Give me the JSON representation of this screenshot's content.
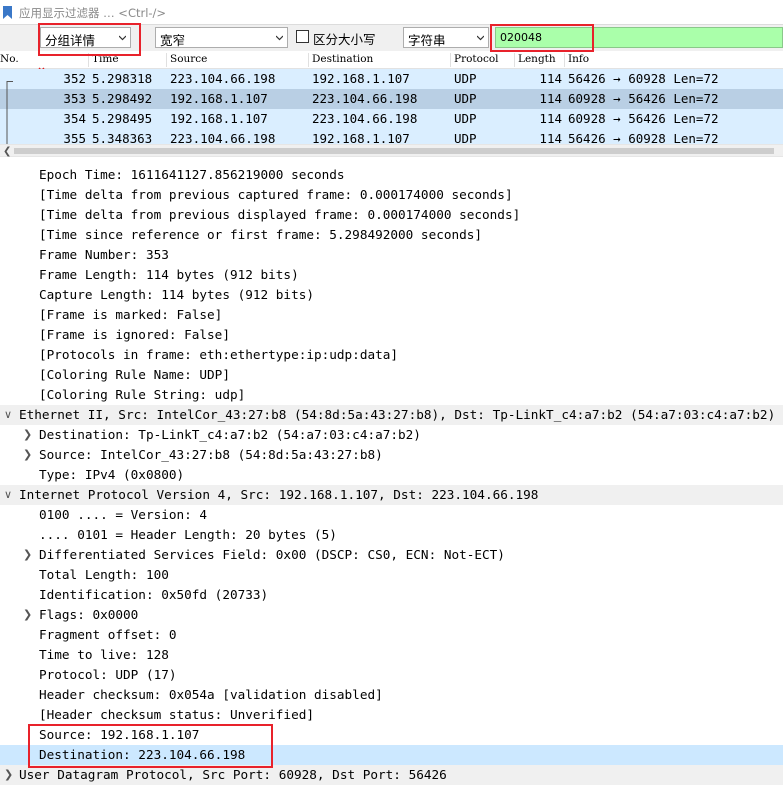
{
  "filter": {
    "placeholder": "应用显示过滤器 … <Ctrl-/>"
  },
  "find": {
    "scope": "分组详情",
    "charset": "宽窄",
    "case_label": "区分大小写",
    "type": "字符串",
    "query": "020048"
  },
  "packet_list": {
    "columns": [
      "No.",
      "Time",
      "Source",
      "Destination",
      "Protocol",
      "Length",
      "Info"
    ],
    "rows": [
      {
        "no": "352",
        "time": "5.298318",
        "src": "223.104.66.198",
        "dst": "192.168.1.107",
        "proto": "UDP",
        "len": "114",
        "info": "56426 → 60928 Len=72"
      },
      {
        "no": "353",
        "time": "5.298492",
        "src": "192.168.1.107",
        "dst": "223.104.66.198",
        "proto": "UDP",
        "len": "114",
        "info": "60928 → 56426 Len=72"
      },
      {
        "no": "354",
        "time": "5.298495",
        "src": "192.168.1.107",
        "dst": "223.104.66.198",
        "proto": "UDP",
        "len": "114",
        "info": "60928 → 56426 Len=72"
      },
      {
        "no": "355",
        "time": "5.348363",
        "src": "223.104.66.198",
        "dst": "192.168.1.107",
        "proto": "UDP",
        "len": "114",
        "info": "56426 → 60928 Len=72"
      }
    ]
  },
  "details": [
    "Epoch Time: 1611641127.856219000 seconds",
    "[Time delta from previous captured frame: 0.000174000 seconds]",
    "[Time delta from previous displayed frame: 0.000174000 seconds]",
    "[Time since reference or first frame: 5.298492000 seconds]",
    "Frame Number: 353",
    "Frame Length: 114 bytes (912 bits)",
    "Capture Length: 114 bytes (912 bits)",
    "[Frame is marked: False]",
    "[Frame is ignored: False]",
    "[Protocols in frame: eth:ethertype:ip:udp:data]",
    "[Coloring Rule Name: UDP]",
    "[Coloring Rule String: udp]",
    "Ethernet II, Src: IntelCor_43:27:b8 (54:8d:5a:43:27:b8), Dst: Tp-LinkT_c4:a7:b2 (54:a7:03:c4:a7:b2)",
    "Destination: Tp-LinkT_c4:a7:b2 (54:a7:03:c4:a7:b2)",
    "Source: IntelCor_43:27:b8 (54:8d:5a:43:27:b8)",
    "Type: IPv4 (0x0800)",
    "Internet Protocol Version 4, Src: 192.168.1.107, Dst: 223.104.66.198",
    "0100 .... = Version: 4",
    ".... 0101 = Header Length: 20 bytes (5)",
    "Differentiated Services Field: 0x00 (DSCP: CS0, ECN: Not-ECT)",
    "Total Length: 100",
    "Identification: 0x50fd (20733)",
    "Flags: 0x0000",
    "Fragment offset: 0",
    "Time to live: 128",
    "Protocol: UDP (17)",
    "Header checksum: 0x054a [validation disabled]",
    "[Header checksum status: Unverified]",
    "Source: 192.168.1.107",
    "Destination: 223.104.66.198",
    "User Datagram Protocol, Src Port: 60928, Dst Port: 56426"
  ],
  "colors": {
    "udp_row": "#daeeff",
    "selected_row": "#b9cfe4",
    "find_match": "#aaffaa",
    "highlight_box": "#e8222b",
    "selected_detail": "#cce8ff"
  }
}
